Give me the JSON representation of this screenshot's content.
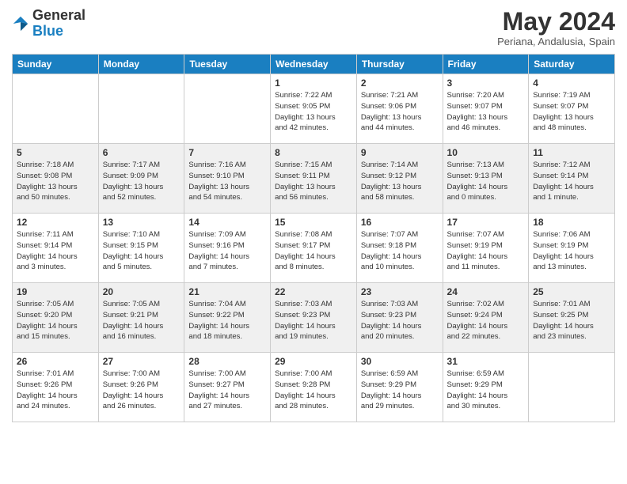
{
  "header": {
    "logo_line1": "General",
    "logo_line2": "Blue",
    "month_title": "May 2024",
    "subtitle": "Periana, Andalusia, Spain"
  },
  "days_of_week": [
    "Sunday",
    "Monday",
    "Tuesday",
    "Wednesday",
    "Thursday",
    "Friday",
    "Saturday"
  ],
  "weeks": [
    [
      {
        "day": "",
        "info": ""
      },
      {
        "day": "",
        "info": ""
      },
      {
        "day": "",
        "info": ""
      },
      {
        "day": "1",
        "info": "Sunrise: 7:22 AM\nSunset: 9:05 PM\nDaylight: 13 hours\nand 42 minutes."
      },
      {
        "day": "2",
        "info": "Sunrise: 7:21 AM\nSunset: 9:06 PM\nDaylight: 13 hours\nand 44 minutes."
      },
      {
        "day": "3",
        "info": "Sunrise: 7:20 AM\nSunset: 9:07 PM\nDaylight: 13 hours\nand 46 minutes."
      },
      {
        "day": "4",
        "info": "Sunrise: 7:19 AM\nSunset: 9:07 PM\nDaylight: 13 hours\nand 48 minutes."
      }
    ],
    [
      {
        "day": "5",
        "info": "Sunrise: 7:18 AM\nSunset: 9:08 PM\nDaylight: 13 hours\nand 50 minutes."
      },
      {
        "day": "6",
        "info": "Sunrise: 7:17 AM\nSunset: 9:09 PM\nDaylight: 13 hours\nand 52 minutes."
      },
      {
        "day": "7",
        "info": "Sunrise: 7:16 AM\nSunset: 9:10 PM\nDaylight: 13 hours\nand 54 minutes."
      },
      {
        "day": "8",
        "info": "Sunrise: 7:15 AM\nSunset: 9:11 PM\nDaylight: 13 hours\nand 56 minutes."
      },
      {
        "day": "9",
        "info": "Sunrise: 7:14 AM\nSunset: 9:12 PM\nDaylight: 13 hours\nand 58 minutes."
      },
      {
        "day": "10",
        "info": "Sunrise: 7:13 AM\nSunset: 9:13 PM\nDaylight: 14 hours\nand 0 minutes."
      },
      {
        "day": "11",
        "info": "Sunrise: 7:12 AM\nSunset: 9:14 PM\nDaylight: 14 hours\nand 1 minute."
      }
    ],
    [
      {
        "day": "12",
        "info": "Sunrise: 7:11 AM\nSunset: 9:14 PM\nDaylight: 14 hours\nand 3 minutes."
      },
      {
        "day": "13",
        "info": "Sunrise: 7:10 AM\nSunset: 9:15 PM\nDaylight: 14 hours\nand 5 minutes."
      },
      {
        "day": "14",
        "info": "Sunrise: 7:09 AM\nSunset: 9:16 PM\nDaylight: 14 hours\nand 7 minutes."
      },
      {
        "day": "15",
        "info": "Sunrise: 7:08 AM\nSunset: 9:17 PM\nDaylight: 14 hours\nand 8 minutes."
      },
      {
        "day": "16",
        "info": "Sunrise: 7:07 AM\nSunset: 9:18 PM\nDaylight: 14 hours\nand 10 minutes."
      },
      {
        "day": "17",
        "info": "Sunrise: 7:07 AM\nSunset: 9:19 PM\nDaylight: 14 hours\nand 11 minutes."
      },
      {
        "day": "18",
        "info": "Sunrise: 7:06 AM\nSunset: 9:19 PM\nDaylight: 14 hours\nand 13 minutes."
      }
    ],
    [
      {
        "day": "19",
        "info": "Sunrise: 7:05 AM\nSunset: 9:20 PM\nDaylight: 14 hours\nand 15 minutes."
      },
      {
        "day": "20",
        "info": "Sunrise: 7:05 AM\nSunset: 9:21 PM\nDaylight: 14 hours\nand 16 minutes."
      },
      {
        "day": "21",
        "info": "Sunrise: 7:04 AM\nSunset: 9:22 PM\nDaylight: 14 hours\nand 18 minutes."
      },
      {
        "day": "22",
        "info": "Sunrise: 7:03 AM\nSunset: 9:23 PM\nDaylight: 14 hours\nand 19 minutes."
      },
      {
        "day": "23",
        "info": "Sunrise: 7:03 AM\nSunset: 9:23 PM\nDaylight: 14 hours\nand 20 minutes."
      },
      {
        "day": "24",
        "info": "Sunrise: 7:02 AM\nSunset: 9:24 PM\nDaylight: 14 hours\nand 22 minutes."
      },
      {
        "day": "25",
        "info": "Sunrise: 7:01 AM\nSunset: 9:25 PM\nDaylight: 14 hours\nand 23 minutes."
      }
    ],
    [
      {
        "day": "26",
        "info": "Sunrise: 7:01 AM\nSunset: 9:26 PM\nDaylight: 14 hours\nand 24 minutes."
      },
      {
        "day": "27",
        "info": "Sunrise: 7:00 AM\nSunset: 9:26 PM\nDaylight: 14 hours\nand 26 minutes."
      },
      {
        "day": "28",
        "info": "Sunrise: 7:00 AM\nSunset: 9:27 PM\nDaylight: 14 hours\nand 27 minutes."
      },
      {
        "day": "29",
        "info": "Sunrise: 7:00 AM\nSunset: 9:28 PM\nDaylight: 14 hours\nand 28 minutes."
      },
      {
        "day": "30",
        "info": "Sunrise: 6:59 AM\nSunset: 9:29 PM\nDaylight: 14 hours\nand 29 minutes."
      },
      {
        "day": "31",
        "info": "Sunrise: 6:59 AM\nSunset: 9:29 PM\nDaylight: 14 hours\nand 30 minutes."
      },
      {
        "day": "",
        "info": ""
      }
    ]
  ]
}
